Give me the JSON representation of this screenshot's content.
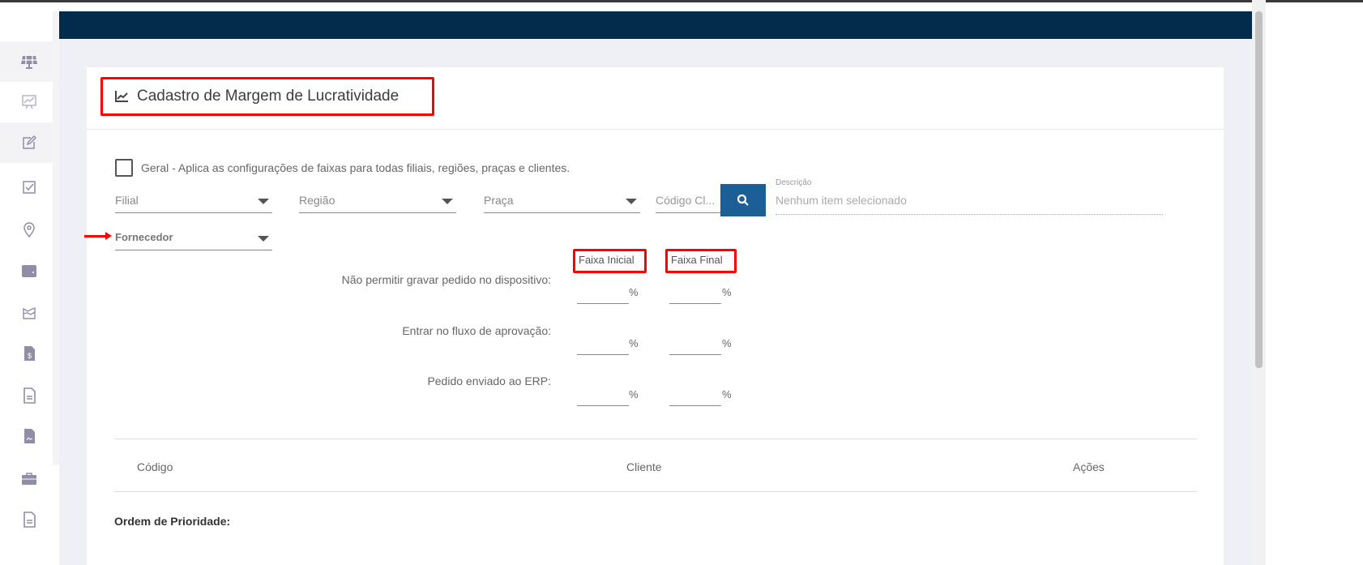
{
  "sidebar": {
    "items": [
      {
        "icon": "solar-panel-icon"
      },
      {
        "icon": "presentation-chart-icon"
      },
      {
        "icon": "edit-icon"
      },
      {
        "icon": "checkbox-icon"
      },
      {
        "icon": "location-pin-icon"
      },
      {
        "icon": "wallet-icon"
      },
      {
        "icon": "area-chart-icon"
      },
      {
        "icon": "invoice-dollar-icon"
      },
      {
        "icon": "document-icon"
      },
      {
        "icon": "document-signature-icon"
      },
      {
        "icon": "briefcase-icon"
      },
      {
        "icon": "document-icon"
      }
    ]
  },
  "page": {
    "title": "Cadastro de Margem de Lucratividade"
  },
  "form": {
    "geral_label": "Geral - Aplica as configurações de faixas para todas filiais, regiões, praças e clientes.",
    "filial": "Filial",
    "regiao": "Região",
    "praca": "Praça",
    "codigo_cliente": "Código Cl...",
    "descricao_label": "Descrição",
    "descricao_value": "Nenhum item selecionado",
    "fornecedor": "Fornecedor",
    "faixa_inicial": "Faixa Inicial",
    "faixa_final": "Faixa Final",
    "percent": "%",
    "rows": [
      {
        "label": "Não permitir gravar pedido no dispositivo:"
      },
      {
        "label": "Entrar no fluxo de aprovação:"
      },
      {
        "label": "Pedido enviado ao ERP:"
      }
    ]
  },
  "table": {
    "headers": [
      "Código",
      "Cliente",
      "Ações"
    ]
  },
  "priority_label": "Ordem de Prioridade:",
  "colors": {
    "header": "#032b4c",
    "accent": "#1c5f98",
    "highlight": "#ff0000"
  }
}
